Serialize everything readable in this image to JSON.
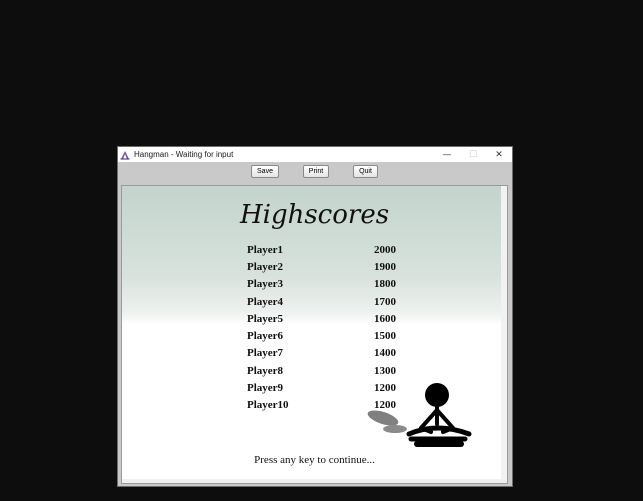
{
  "window": {
    "title": "Hangman - Waiting for input",
    "minimize_glyph": "—",
    "maximize_glyph": "☐",
    "close_glyph": "✕"
  },
  "toolbar": {
    "save_label": "Save",
    "print_label": "Print",
    "quit_label": "Quit"
  },
  "highscores": {
    "title": "Highscores",
    "entries": [
      {
        "name": "Player1",
        "score": "2000"
      },
      {
        "name": "Player2",
        "score": "1900"
      },
      {
        "name": "Player3",
        "score": "1800"
      },
      {
        "name": "Player4",
        "score": "1700"
      },
      {
        "name": "Player5",
        "score": "1600"
      },
      {
        "name": "Player6",
        "score": "1500"
      },
      {
        "name": "Player7",
        "score": "1400"
      },
      {
        "name": "Player8",
        "score": "1300"
      },
      {
        "name": "Player9",
        "score": "1200"
      },
      {
        "name": "Player10",
        "score": "1200"
      }
    ]
  },
  "footer": {
    "message": "Press any key to continue..."
  },
  "icons": {
    "app": "hangman-app-icon",
    "mascot": "meditating-stick-figure-icon"
  }
}
